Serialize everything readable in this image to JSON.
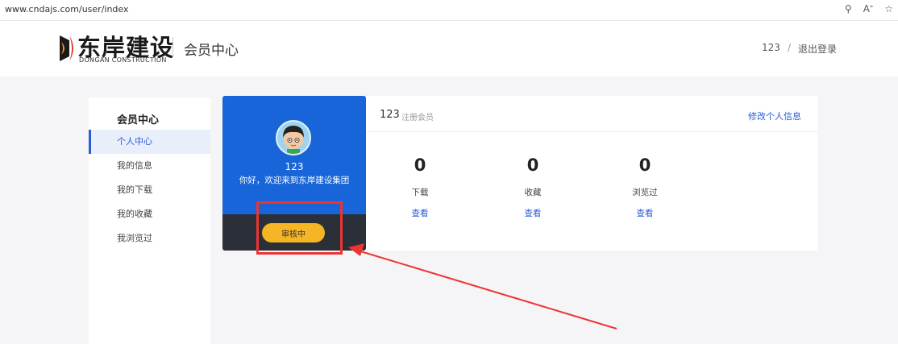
{
  "browser": {
    "url": "www.cndajs.com/user/index",
    "icons": [
      "key-icon",
      "read-aloud-icon",
      "favorite-star-icon"
    ]
  },
  "header": {
    "logo_cn": "东岸建设",
    "logo_en": "DONGAN CONSTRUCTION",
    "title": "会员中心",
    "username": "123",
    "separator": "/",
    "logout": "退出登录"
  },
  "sidebar": {
    "title": "会员中心",
    "items": [
      {
        "label": "个人中心",
        "active": true
      },
      {
        "label": "我的信息"
      },
      {
        "label": "我的下载"
      },
      {
        "label": "我的收藏"
      },
      {
        "label": "我浏览过"
      }
    ]
  },
  "profile": {
    "name": "123",
    "welcome": "你好，欢迎来到东岸建设集团",
    "status_button": "审核中"
  },
  "stats": {
    "username": "123",
    "role": "注册会员",
    "edit_link": "修改个人信息",
    "items": [
      {
        "value": "0",
        "label": "下载",
        "link": "查看"
      },
      {
        "value": "0",
        "label": "收藏",
        "link": "查看"
      },
      {
        "value": "0",
        "label": "浏览过",
        "link": "查看"
      }
    ]
  },
  "colors": {
    "brand_blue": "#1765d8",
    "accent_yellow": "#f6b524",
    "highlight_red": "#e33333",
    "link_blue": "#2a5bd7"
  }
}
